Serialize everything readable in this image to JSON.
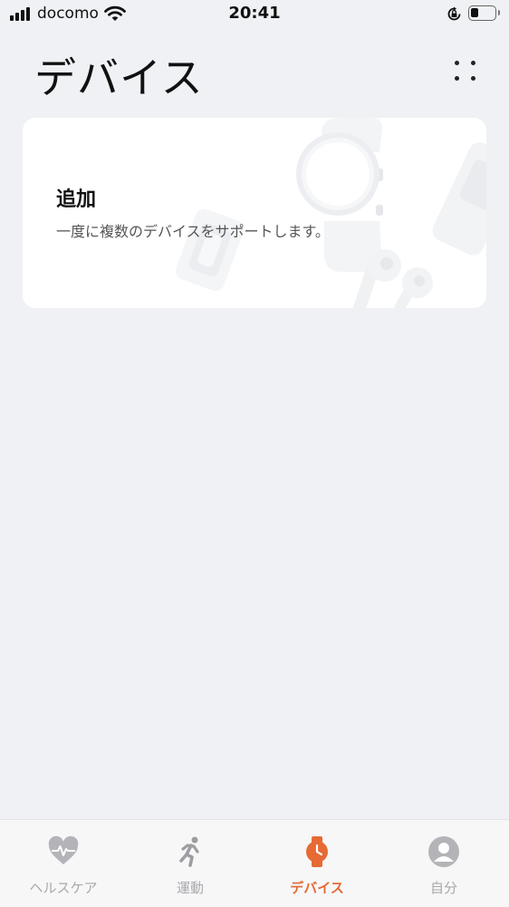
{
  "status_bar": {
    "carrier": "docomo",
    "time": "20:41",
    "battery_level": 0.35
  },
  "header": {
    "title": "デバイス"
  },
  "add_card": {
    "title": "追加",
    "description": "一度に複数のデバイスをサポートします。"
  },
  "tabs": [
    {
      "label": "ヘルスケア",
      "icon": "heart-pulse-icon",
      "active": false
    },
    {
      "label": "運動",
      "icon": "running-person-icon",
      "active": false
    },
    {
      "label": "デバイス",
      "icon": "watch-icon",
      "active": true
    },
    {
      "label": "自分",
      "icon": "person-avatar-icon",
      "active": false
    }
  ],
  "colors": {
    "background": "#eff1f4",
    "card": "#ffffff",
    "accent": "#e66a34",
    "tab_inactive": "#a9a9ad"
  }
}
